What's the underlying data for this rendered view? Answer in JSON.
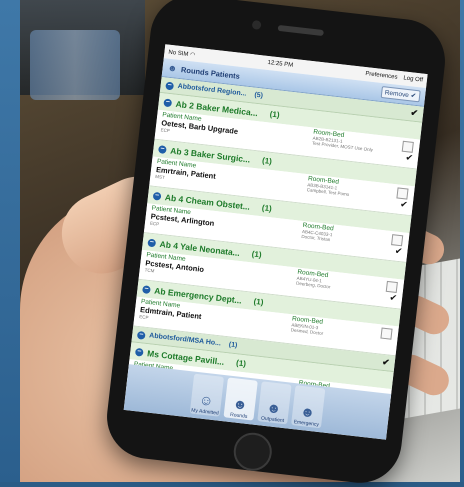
{
  "status": {
    "carrier": "No SIM",
    "wifi": "wifi",
    "time": "12:25 PM",
    "preferences": "Preferences",
    "logoff": "Log Off"
  },
  "header": {
    "title": "Rounds Patients",
    "remove_label": "Remove"
  },
  "regions": [
    {
      "name": "Abbotsford Region...",
      "count": "(5)"
    },
    {
      "name": "Abbotsford/MSA Ho...",
      "count": "(1)"
    }
  ],
  "units": [
    {
      "name": "Ab 2 Baker Medica...",
      "count": "(1)",
      "patient_label": "Patient Name",
      "room_label": "Room-Bed",
      "patient": "Oetest, Barb Upgrade",
      "sub": "ECP",
      "bed": "AB2B-B2131-1",
      "attending": "Test Provider, MOST Use Only"
    },
    {
      "name": "Ab 3 Baker Surgic...",
      "count": "(1)",
      "patient_label": "Patient Name",
      "room_label": "Room-Bed",
      "patient": "Emrtrain, Patient",
      "sub": "MST",
      "bed": "AB3B-B3141-1",
      "attending": "Campbell, Test Pomo"
    },
    {
      "name": "Ab 4 Cheam Obstet...",
      "count": "(1)",
      "patient_label": "Patient Name",
      "room_label": "Room-Bed",
      "patient": "Pcstest, Arlington",
      "sub": "ECP",
      "bed": "AB4C-C4033-1",
      "attending": "Doctor, Tristan"
    },
    {
      "name": "Ab 4 Yale Neonata...",
      "count": "(1)",
      "patient_label": "Patient Name",
      "room_label": "Room-Bed",
      "patient": "Pcstest, Antonio",
      "sub": "TCM",
      "bed": "AB4YU-04-1",
      "attending": "Deerberg, Doctor"
    },
    {
      "name": "Ab Emergency Dept...",
      "count": "(1)",
      "patient_label": "Patient Name",
      "room_label": "Room-Bed",
      "patient": "Edmtrain, Patient",
      "sub": "ECP",
      "bed": "ABEKIN-01-3",
      "attending": "Desmed, Doctor"
    },
    {
      "name": "Ms Cottage Pavill...",
      "count": "(1)",
      "patient_label": "Patient Name",
      "room_label": "Room-Bed"
    }
  ],
  "tabs": [
    {
      "label": "My Admitted",
      "icon": "person-icon"
    },
    {
      "label": "Rounds",
      "icon": "group-icon"
    },
    {
      "label": "Outpatient",
      "icon": "group-icon"
    },
    {
      "label": "Emergency",
      "icon": "group-icon"
    }
  ],
  "colors": {
    "accent": "#1e7b2a",
    "header": "#aac7e7",
    "link": "#1e5a9c"
  }
}
